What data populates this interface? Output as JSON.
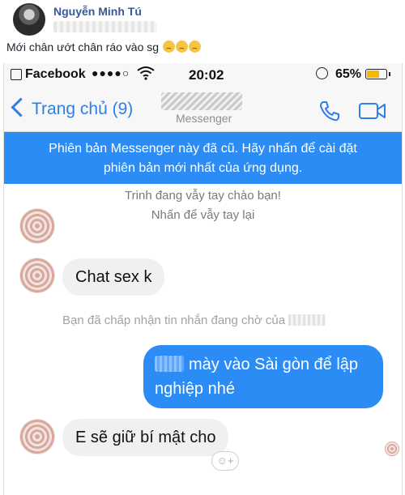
{
  "post": {
    "author": "Nguyễn Minh Tú",
    "caption": "Mới chân ướt chân ráo vào sg"
  },
  "status_bar": {
    "app": "Facebook",
    "signal": "●●●●○",
    "time": "20:02",
    "battery": "65%",
    "battery_level": 0.65,
    "battery_color": "#f5b700"
  },
  "messenger": {
    "back_label": "Trang chủ (9)",
    "subtitle": "Messenger",
    "banner": [
      "Phiên bản Messenger này đã cũ. Hãy nhấn để cài đặt",
      "phiên bản mới nhất của ứng dụng."
    ],
    "wave_notice": [
      "Trinh đang vẫy tay chào bạn!",
      "Nhấn để vẫy tay lại"
    ],
    "messages": [
      {
        "from": "them",
        "text": "Chat sex k"
      },
      {
        "from": "system",
        "text": "Bạn đã chấp nhận tin nhắn đang chờ của"
      },
      {
        "from": "me",
        "lines": [
          "mày vào Sài gòn để lập",
          "nghiệp nhé"
        ]
      },
      {
        "from": "them",
        "text": "E sẽ giữ bí mật cho"
      }
    ],
    "react_icon": "☺+",
    "accent_color": "#2c8cf5"
  }
}
